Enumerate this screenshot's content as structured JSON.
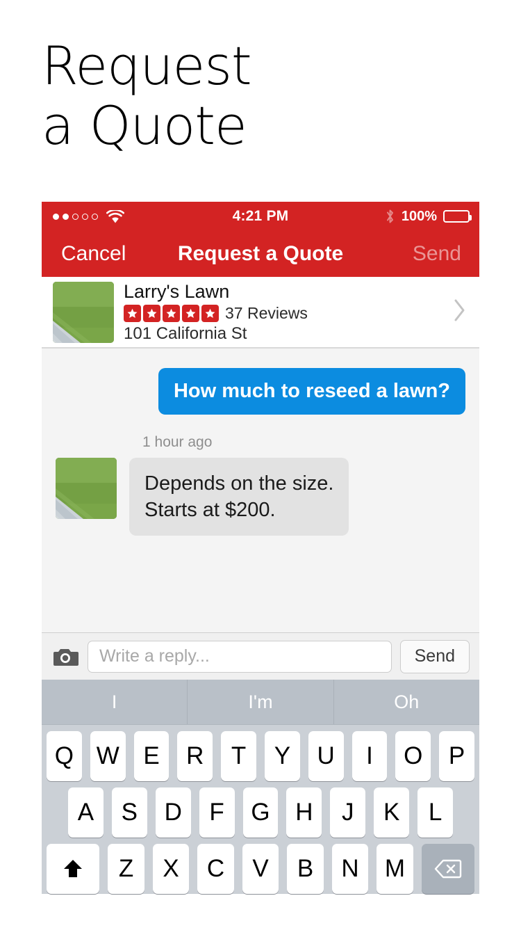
{
  "headline": "Request\na Quote",
  "status_bar": {
    "signal_dots_filled": 2,
    "signal_dots_total": 5,
    "wifi_icon": "wifi-icon",
    "time": "4:21 PM",
    "bluetooth_icon": "bluetooth-icon",
    "battery_percent": "100%",
    "battery_icon": "battery-full-icon"
  },
  "nav_bar": {
    "cancel_label": "Cancel",
    "title": "Request a Quote",
    "send_label": "Send",
    "background_color": "#D32323"
  },
  "business": {
    "thumbnail_icon": "lawn-photo-thumbnail",
    "name": "Larry's Lawn",
    "stars": 5,
    "star_color": "#D32323",
    "reviews": "37 Reviews",
    "address": "101 California St",
    "chevron_icon": "chevron-right-icon"
  },
  "conversation": {
    "outgoing": {
      "text": "How much to reseed a lawn?",
      "bubble_color": "#0C8CE0"
    },
    "timestamp": "1 hour ago",
    "incoming": {
      "avatar_icon": "lawn-photo-avatar",
      "text": "Depends on the size.\nStarts at $200.",
      "bubble_color": "#E2E2E2"
    }
  },
  "reply_bar": {
    "camera_icon": "camera-icon",
    "placeholder": "Write a reply...",
    "input_value": "",
    "send_label": "Send"
  },
  "keyboard": {
    "suggestions": [
      "I",
      "I'm",
      "Oh"
    ],
    "row1": [
      "Q",
      "W",
      "E",
      "R",
      "T",
      "Y",
      "U",
      "I",
      "O",
      "P"
    ],
    "row2": [
      "A",
      "S",
      "D",
      "F",
      "G",
      "H",
      "J",
      "K",
      "L"
    ],
    "row3": [
      "Z",
      "X",
      "C",
      "V",
      "B",
      "N",
      "M"
    ],
    "shift_icon": "shift-icon",
    "delete_icon": "backspace-icon"
  }
}
